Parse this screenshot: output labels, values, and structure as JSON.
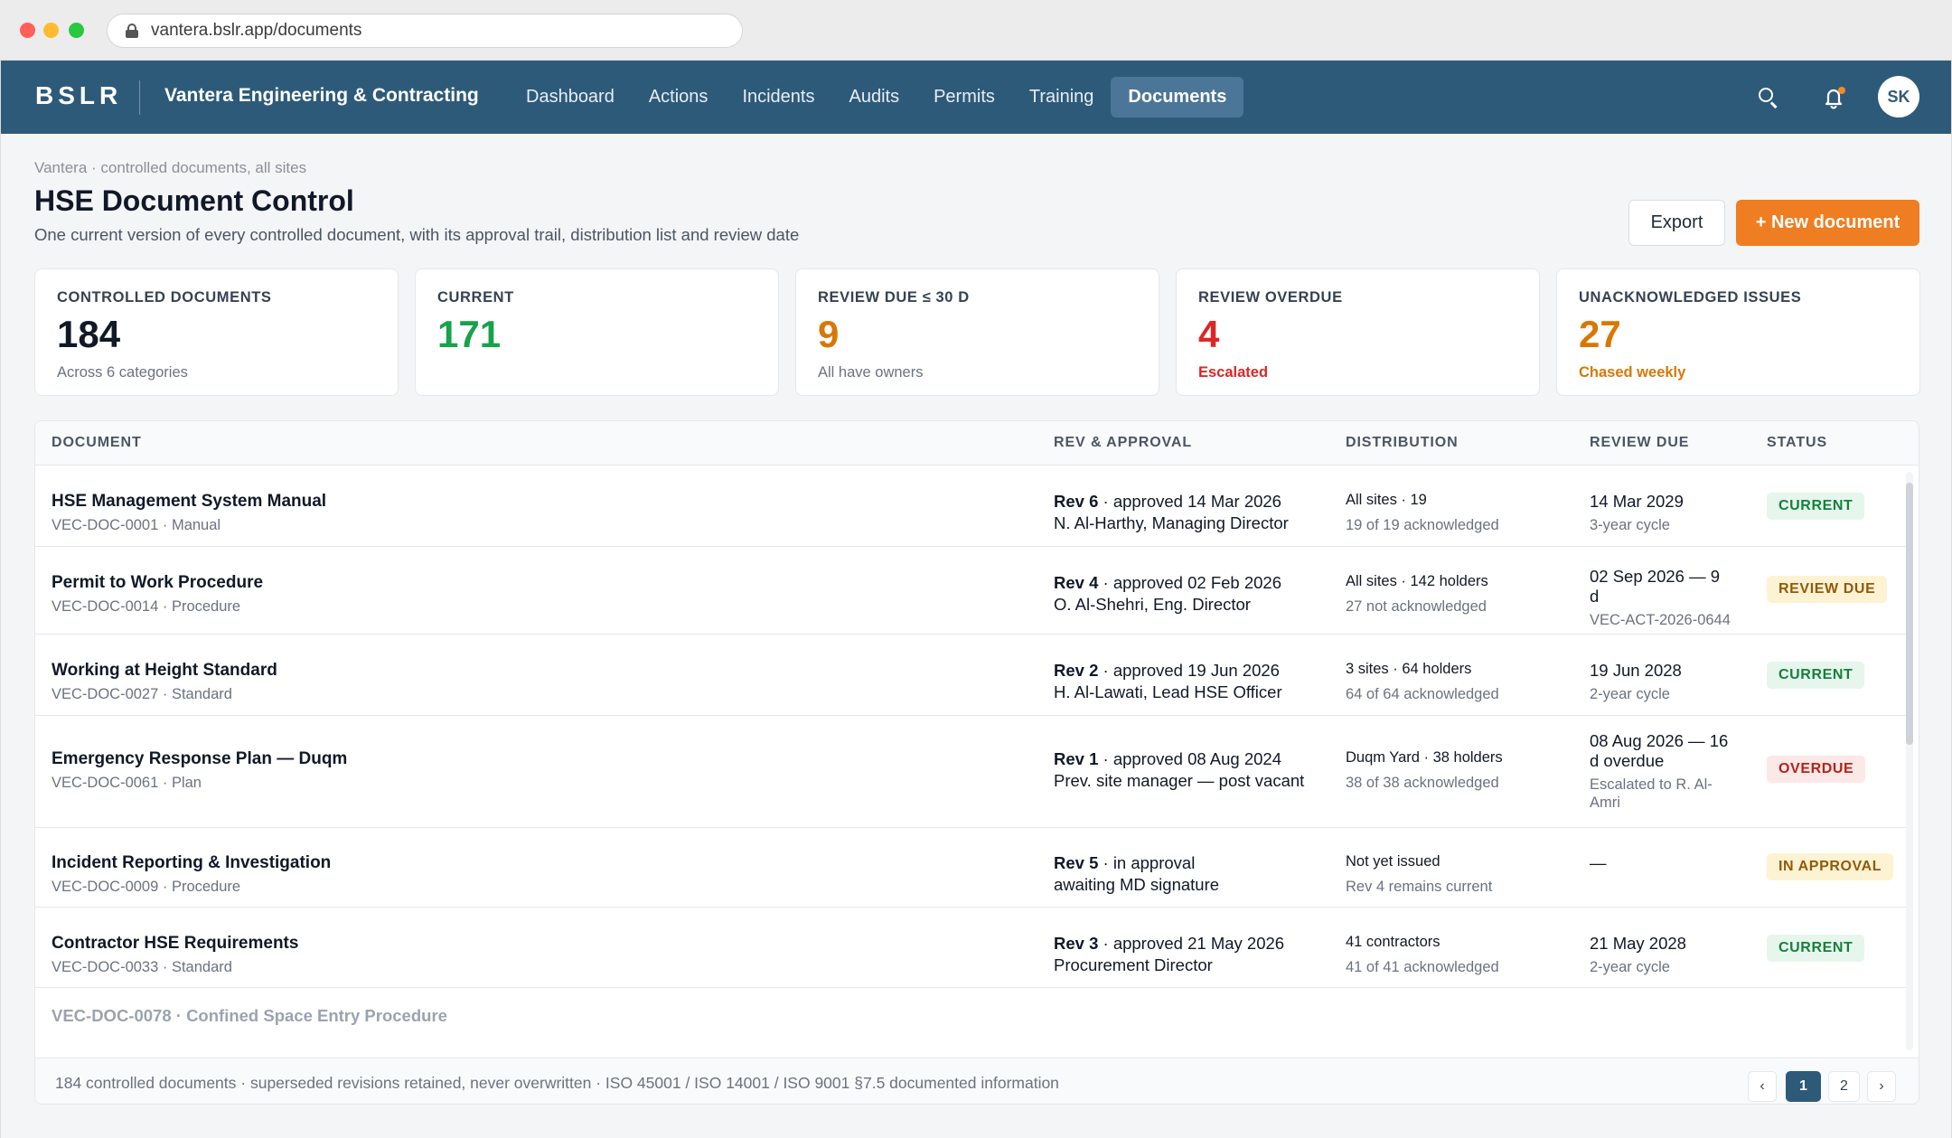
{
  "browser": {
    "url": "vantera.bslr.app/documents"
  },
  "header": {
    "brand": "BSLR",
    "org": "Vantera Engineering & Contracting",
    "nav": [
      "Dashboard",
      "Actions",
      "Incidents",
      "Audits",
      "Permits",
      "Training",
      "Documents"
    ],
    "active_nav": "Documents",
    "avatar": "SK",
    "notification_color": "#f28c28",
    "bar_color": "#2e5a7a"
  },
  "page": {
    "breadcrumb": "Vantera · controlled documents, all sites",
    "title": "HSE Document Control",
    "subtitle": "One current version of every controlled document, with its approval trail, distribution list and review date",
    "export_label": "Export",
    "new_label": "+ New document",
    "accent": "#ef7d22"
  },
  "kpis": [
    {
      "label": "CONTROLLED DOCUMENTS",
      "value": "184",
      "note": "Across 6 categories",
      "color": "#111827",
      "note_color": "#6b7280"
    },
    {
      "label": "CURRENT",
      "value": "171",
      "note": "",
      "color": "#16a34a",
      "note_color": "#6b7280"
    },
    {
      "label": "REVIEW DUE ≤ 30 D",
      "value": "9",
      "note": "All have owners",
      "color": "#d97706",
      "note_color": "#6b7280"
    },
    {
      "label": "REVIEW OVERDUE",
      "value": "4",
      "note": "Escalated",
      "color": "#dc2626",
      "note_color": "#dc2626"
    },
    {
      "label": "UNACKNOWLEDGED ISSUES",
      "value": "27",
      "note": "Chased weekly",
      "color": "#d97706",
      "note_color": "#d97706"
    }
  ],
  "table": {
    "headers": [
      "DOCUMENT",
      "REV & APPROVAL",
      "DISTRIBUTION",
      "REVIEW DUE",
      "STATUS"
    ],
    "rows": [
      {
        "title": "HSE Management System Manual",
        "meta": "VEC-DOC-0001 · Manual",
        "rev": "Rev 6",
        "rev_text": " · approved 14 Mar 2026",
        "by": "N. Al-Harthy, Managing Director",
        "dist": "All sites · 19",
        "dist_sub": "19 of 19 acknowledged",
        "review": "14 Mar 2029",
        "review_sub": "3-year cycle",
        "status": "CURRENT",
        "status_kind": "current"
      },
      {
        "title": "Permit to Work Procedure",
        "meta": "VEC-DOC-0014 · Procedure",
        "rev": "Rev 4",
        "rev_text": " · approved 02 Feb 2026",
        "by": "O. Al-Shehri, Eng. Director",
        "dist": "All sites · 142 holders",
        "dist_sub": "27 not acknowledged",
        "review": "02 Sep 2026 — 9 d",
        "review_sub": "VEC-ACT-2026-0644",
        "status": "REVIEW DUE",
        "status_kind": "review"
      },
      {
        "title": "Working at Height Standard",
        "meta": "VEC-DOC-0027 · Standard",
        "rev": "Rev 2",
        "rev_text": " · approved 19 Jun 2026",
        "by": "H. Al-Lawati, Lead HSE Officer",
        "dist": "3 sites · 64 holders",
        "dist_sub": "64 of 64 acknowledged",
        "review": "19 Jun 2028",
        "review_sub": "2-year cycle",
        "status": "CURRENT",
        "status_kind": "current"
      },
      {
        "title": "Emergency Response Plan — Duqm",
        "meta": "VEC-DOC-0061 · Plan",
        "rev": "Rev 1",
        "rev_text": " · approved 08 Aug 2024",
        "by": "Prev. site manager — post vacant",
        "dist": "Duqm Yard · 38 holders",
        "dist_sub": "38 of 38 acknowledged",
        "review": "08 Aug 2026 — 16 d overdue",
        "review_sub": "Escalated to R. Al-Amri",
        "status": "OVERDUE",
        "status_kind": "overdue"
      },
      {
        "title": "Incident Reporting & Investigation",
        "meta": "VEC-DOC-0009 · Procedure",
        "rev": "Rev 5",
        "rev_text": " · in approval",
        "by": "awaiting MD signature",
        "dist": "Not yet issued",
        "dist_sub": "Rev 4 remains current",
        "review": "—",
        "review_sub": "",
        "status": "IN APPROVAL",
        "status_kind": "approval"
      },
      {
        "title": "Contractor HSE Requirements",
        "meta": "VEC-DOC-0033 · Standard",
        "rev": "Rev 3",
        "rev_text": " · approved 21 May 2026",
        "by": "Procurement Director",
        "dist": "41 contractors",
        "dist_sub": "41 of 41 acknowledged",
        "review": "21 May 2028",
        "review_sub": "2-year cycle",
        "status": "CURRENT",
        "status_kind": "current"
      }
    ],
    "partial_row": "VEC-DOC-0078 · Confined Space Entry Procedure",
    "footnote": "184 controlled documents · superseded revisions retained, never overwritten · ISO 45001 / ISO 14001 / ISO 9001 §7.5 documented information",
    "pagination": {
      "prev": "‹",
      "pages": [
        "1",
        "2"
      ],
      "active": "1",
      "next": "›"
    }
  }
}
